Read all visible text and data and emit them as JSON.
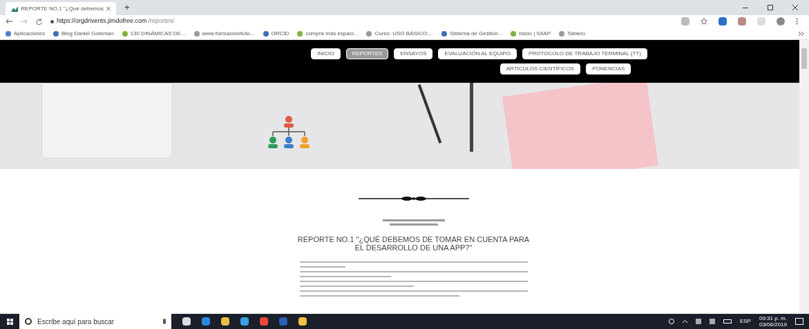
{
  "browser": {
    "tab_title": "REPORTE NO.1 \"¿Qué debemos",
    "new_tab": "+",
    "url_host": "https://orgdrivents.jimdofree.com",
    "url_path": "/reportes/",
    "bookmarks": [
      "Aplicaciones",
      "Blog Daniel Goleman",
      "130 DINÁMICAS DE...",
      "www.formacionituto...",
      "ORCID",
      "compra más espaci...",
      "Curso: USO BÁSICO:...",
      "Sistema de Gestión...",
      "Inicio | SIIAP",
      "Tablero"
    ]
  },
  "nav": [
    {
      "label": "INICIO",
      "selected": false
    },
    {
      "label": "REPORTES",
      "selected": true
    },
    {
      "label": "ENSAYOS",
      "selected": false
    },
    {
      "label": "EVALUACIÓN AL EQUIPO",
      "selected": false
    },
    {
      "label": "PROTOCOLO DE TRABAJO TERMINAL (TT)",
      "selected": false
    },
    {
      "label": "ARTÍCULOS CIENTÍFICOS",
      "selected": false
    },
    {
      "label": "PONENCIAS",
      "selected": false
    }
  ],
  "article": {
    "title": "REPORTE NO.1 \"¿QUÉ DEBEMOS DE TOMAR EN CUENTA PARA EL DESARROLLO DE UNA APP?\""
  },
  "taskbar": {
    "search_placeholder": "Escribe aquí para buscar",
    "language": "ESP",
    "time": "09:31 p. m.",
    "date": "03/06/2019"
  }
}
